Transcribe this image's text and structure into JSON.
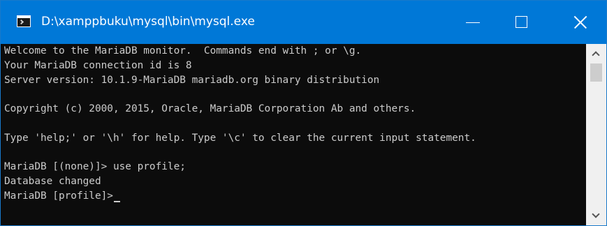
{
  "window": {
    "title": "D:\\xamppbuku\\mysql\\bin\\mysql.exe",
    "controls": {
      "minimize": "minimize",
      "maximize": "maximize",
      "close": "close"
    }
  },
  "console": {
    "lines": [
      "Welcome to the MariaDB monitor.  Commands end with ; or \\g.",
      "Your MariaDB connection id is 8",
      "Server version: 10.1.9-MariaDB mariadb.org binary distribution",
      "",
      "Copyright (c) 2000, 2015, Oracle, MariaDB Corporation Ab and others.",
      "",
      "Type 'help;' or '\\h' for help. Type '\\c' to clear the current input statement.",
      "",
      "MariaDB [(none)]> use profile;",
      "Database changed",
      "MariaDB [profile]>"
    ]
  },
  "colors": {
    "titlebar": "#0078d7",
    "console_bg": "#0c0c0c",
    "console_text": "#cccccc",
    "scrollbar_track": "#f0f0f0",
    "scrollbar_thumb": "#cdcdcd"
  },
  "icons": {
    "app": "console-app-icon",
    "minimize": "minimize-icon",
    "maximize": "maximize-icon",
    "close": "close-icon",
    "scroll_up": "chevron-up-icon",
    "scroll_down": "chevron-down-icon"
  }
}
